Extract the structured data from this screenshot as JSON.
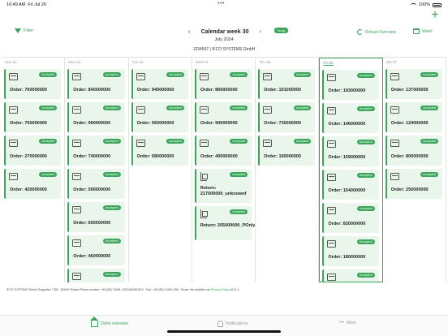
{
  "status_bar": {
    "time": "10:49 AM",
    "date": "Fri Jul 26",
    "dots": "•••",
    "battery": "100%"
  },
  "header": {
    "filter_label": "Filter",
    "week_title": "Calendar week 30",
    "prev_icon": "chevron-left-icon",
    "next_icon": "chevron-right-icon",
    "today_label": "Today",
    "month": "July 2024",
    "customer": "1234567 | IFCO SYSTEMS GmbH",
    "reload_label": "Reload Overview",
    "week_label": "Week",
    "add_icon": "plus-icon"
  },
  "days": [
    {
      "label": "Sun 21.",
      "selected": false,
      "orders": [
        {
          "kind": "order",
          "status": "Accepted",
          "title": "Order: 760000000"
        },
        {
          "kind": "order",
          "status": "Accepted",
          "title": "Order: 750000000"
        },
        {
          "kind": "order",
          "status": "Accepted",
          "title": "Order: 270000000"
        },
        {
          "kind": "order",
          "status": "Accepted",
          "title": "Order: 420000000"
        }
      ]
    },
    {
      "label": "Mon 22.",
      "selected": false,
      "orders": [
        {
          "kind": "order",
          "status": "Accepted",
          "title": "Order: 840000000"
        },
        {
          "kind": "order",
          "status": "Accepted",
          "title": "Order: 990000000"
        },
        {
          "kind": "order",
          "status": "Accepted",
          "title": "Order: 740000000"
        },
        {
          "kind": "order",
          "status": "Accepted",
          "title": "Order: 590000000"
        },
        {
          "kind": "order",
          "status": "Accepted",
          "title": "Order: 600000000"
        },
        {
          "kind": "order",
          "status": "Accepted",
          "title": "Order: 460000000"
        },
        {
          "kind": "order",
          "status": "Accepted",
          "title": ""
        }
      ]
    },
    {
      "label": "Tue 23.",
      "selected": false,
      "orders": [
        {
          "kind": "order",
          "status": "Accepted",
          "title": "Order: 940000000"
        },
        {
          "kind": "order",
          "status": "Accepted",
          "title": "Order: 560000000"
        },
        {
          "kind": "order",
          "status": "Accepted",
          "title": "Order: 580000000"
        }
      ]
    },
    {
      "label": "Wed 24.",
      "selected": false,
      "orders": [
        {
          "kind": "order",
          "status": "Accepted",
          "title": "Order: 860000000"
        },
        {
          "kind": "order",
          "status": "Accepted",
          "title": "Order: 900000000"
        },
        {
          "kind": "order",
          "status": "Accepted",
          "title": "Order: 400000000"
        },
        {
          "kind": "return",
          "status": "Accepted",
          "title": "Return: 217000000_unknownf"
        },
        {
          "kind": "return",
          "status": "Accepted",
          "title": "Return: 205000000_POnly"
        }
      ]
    },
    {
      "label": "Thu 25.",
      "selected": false,
      "orders": [
        {
          "kind": "order",
          "status": "Accepted",
          "title": "Order: 191000000"
        },
        {
          "kind": "order",
          "status": "Accepted",
          "title": "Order: 730000000"
        },
        {
          "kind": "order",
          "status": "Accepted",
          "title": "Order: 190000000"
        }
      ]
    },
    {
      "label": "Fri 26.",
      "selected": true,
      "orders": [
        {
          "kind": "order",
          "status": "Accepted",
          "title": "Order: 193000000"
        },
        {
          "kind": "order",
          "status": "Accepted",
          "title": "Order: 146000000"
        },
        {
          "kind": "order",
          "status": "Accepted",
          "title": "Order: 159000000"
        },
        {
          "kind": "order",
          "status": "Accepted",
          "title": "Order: 154000000"
        },
        {
          "kind": "order",
          "status": "Accepted",
          "title": "Order: 830000000"
        },
        {
          "kind": "order",
          "status": "Accepted",
          "title": "Order: 180000000"
        },
        {
          "kind": "order",
          "status": "Accepted",
          "title": ""
        }
      ]
    },
    {
      "label": "Sat 27.",
      "selected": false,
      "orders": [
        {
          "kind": "order",
          "status": "Accepted",
          "title": "Order: 137000000"
        },
        {
          "kind": "order",
          "status": "Accepted",
          "title": "Order: 124000000"
        },
        {
          "kind": "order",
          "status": "Accepted",
          "title": "Order: 800000000"
        },
        {
          "kind": "order",
          "status": "Accepted",
          "title": "Order: 250000000"
        }
      ]
    }
  ],
  "footer": {
    "info": "IFCO SYSTEMS GmbH Zugspitze 7 DE - 82049 Pullach Phone number: +49 (89) 74491-132/346/351/512 · Fax: +49 (89) 74491-290 · Email: ifco.de@ifco.de",
    "privacy_label": "Privacy Policy",
    "version": "v2.11.0"
  },
  "tabs": [
    {
      "label": "Order overview",
      "icon": "house-icon",
      "active": true
    },
    {
      "label": "Notifications",
      "icon": "bell-icon",
      "active": false
    },
    {
      "label": "More",
      "icon": "more-icon",
      "active": false
    }
  ],
  "colors": {
    "accent": "#3aa55b",
    "card_bg": "#eaf6ec"
  }
}
